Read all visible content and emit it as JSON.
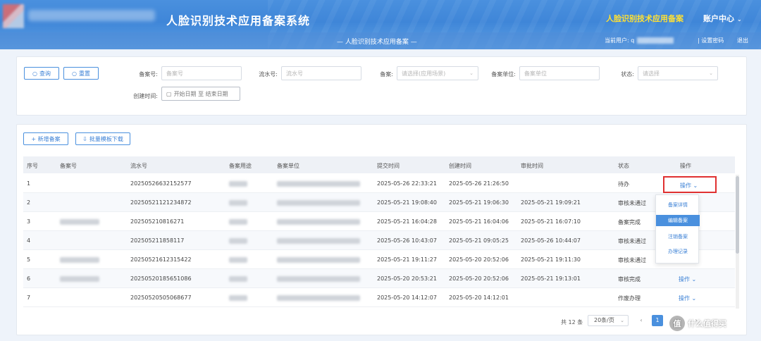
{
  "header": {
    "system_title": "人脸识别技术应用备案系统",
    "highlight_title": "人脸识别技术应用备案",
    "account_menu": "账户中心",
    "account_chevron": "⌄",
    "sub_title": "— 人脸识别技术应用备案 —",
    "current_user_label": "当前用户:",
    "current_user_initial": "q",
    "link_change_password": "| 设置密码",
    "link_logout": "退出"
  },
  "search": {
    "query_button": "查询",
    "query_icon": "○",
    "reset_button": "重置",
    "reset_icon": "○",
    "fields": [
      {
        "label": "备案号:",
        "placeholder": "备案号"
      },
      {
        "label": "流水号:",
        "placeholder": "流水号"
      },
      {
        "label": "备案:",
        "placeholder": "请选择(应用场景)",
        "has_arrow": true
      },
      {
        "label": "备案单位:",
        "placeholder": "备案单位"
      },
      {
        "label": "状态:",
        "placeholder": "请选择",
        "has_arrow": true
      }
    ],
    "date_label": "创建时间:",
    "date_placeholder": "开始日期 至 结束日期"
  },
  "toolbar": {
    "add_button": "+ 新增备案",
    "batch_button": "批量模板下载"
  },
  "table": {
    "columns": [
      "序号",
      "备案号",
      "流水号",
      "备案用途",
      "备案单位",
      "提交时间",
      "创建时间",
      "审批时间",
      "状态",
      "操作"
    ],
    "rows": [
      {
        "index": "1",
        "serial": "20250526632152577",
        "submit_time": "2025-05-26 22:33:21",
        "create_time": "2025-05-26 21:26:50",
        "approve_time": "",
        "status": "待办",
        "op": "操作 ⌄"
      },
      {
        "index": "2",
        "serial": "20250521121234872",
        "submit_time": "2025-05-21 19:08:40",
        "create_time": "2025-05-21 19:06:30",
        "approve_time": "2025-05-21 19:09:21",
        "status": "审核未通过",
        "op": ""
      },
      {
        "index": "3",
        "serial": "202505210816271",
        "submit_time": "2025-05-21 16:04:28",
        "create_time": "2025-05-21 16:04:06",
        "approve_time": "2025-05-21 16:07:10",
        "status": "备案完成",
        "op": ""
      },
      {
        "index": "4",
        "serial": "202505211858117",
        "submit_time": "2025-05-26 10:43:07",
        "create_time": "2025-05-21 09:05:25",
        "approve_time": "2025-05-26 10:44:07",
        "status": "审核未通过",
        "op": ""
      },
      {
        "index": "5",
        "serial": "20250521612315422",
        "submit_time": "2025-05-21 19:11:27",
        "create_time": "2025-05-20 20:52:06",
        "approve_time": "2025-05-21 19:11:30",
        "status": "审核未通过",
        "op": ""
      },
      {
        "index": "6",
        "serial": "20250520185651086",
        "submit_time": "2025-05-20 20:53:21",
        "create_time": "2025-05-20 20:52:06",
        "approve_time": "2025-05-21 19:13:01",
        "status": "审核完成",
        "op": "操作 ⌄"
      },
      {
        "index": "7",
        "serial": "20250520505068677",
        "submit_time": "2025-05-20 14:12:07",
        "create_time": "2025-05-20 14:12:01",
        "approve_time": "",
        "status": "作废办理",
        "op": "操作 ⌄"
      }
    ]
  },
  "op_dropdown": {
    "trigger_label": "操作 ⌄",
    "items": [
      "备案详情",
      "编辑备案",
      "注销备案",
      "办理记录"
    ],
    "active_index": 1
  },
  "pager": {
    "total": "共 12 条",
    "page_size": "20条/页",
    "page_size_arrow": "⌄",
    "prev": "‹",
    "current_page": "1",
    "next": "›"
  },
  "watermark": {
    "icon": "值",
    "text": "什么值得买"
  }
}
